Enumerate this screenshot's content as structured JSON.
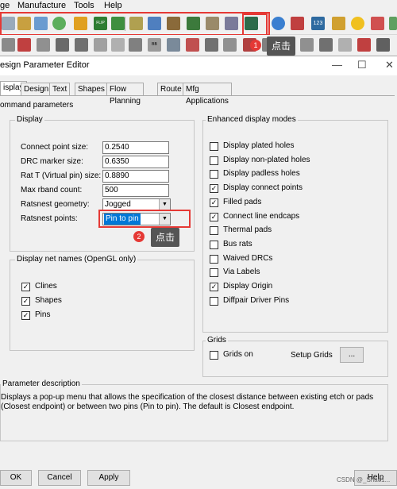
{
  "menubar": {
    "items": [
      "ge",
      "Manufacture",
      "Tools",
      "Help"
    ]
  },
  "toolbar1": {
    "icons": [
      "zoom-icon",
      "zoom-fit-icon",
      "zoom-prev-icon",
      "refresh-icon",
      "3d-view-icon",
      "flip-icon",
      "image-icon",
      "layer-icon",
      "grid-icon",
      "move-icon",
      "placement-icon",
      "route-icon",
      "plot-icon",
      "report-icon",
      "design-parameters-icon",
      "info-icon",
      "pin-icon",
      "reports-123-icon",
      "clean-icon",
      "sun-icon",
      "highlight-icon",
      "drc-icon"
    ],
    "flip_label": "FLIP",
    "count_label": "123"
  },
  "toolbar2": {
    "icons": [
      "dim-icon",
      "align-icon",
      "stretch-icon",
      "spacing-icon",
      "film-icon",
      "pad-icon",
      "slide-icon",
      "via-icon",
      "bbvia-icon",
      "fanout-icon",
      "pinswap-icon",
      "netlog-icon",
      "arc-icon",
      "phase-icon",
      "add-icon",
      "split-icon",
      "text-icon",
      "shape-icon",
      "delay-icon",
      "stack-icon",
      "copy-icon",
      "mirror-icon",
      "analyze-icon",
      "wizard-icon"
    ],
    "bbvia_label": "BB"
  },
  "callouts": [
    {
      "number": "1",
      "text": "点击"
    },
    {
      "number": "2",
      "text": "点击"
    }
  ],
  "dialog": {
    "title": "esign Parameter Editor",
    "window_controls": {
      "minimize": "—",
      "maximize": "☐",
      "close": "✕"
    },
    "tabs": [
      "isplay",
      "Design",
      "Text",
      "Shapes",
      "Flow Planning",
      "Route",
      "Mfg Applications"
    ],
    "section_label": "ommand parameters",
    "display_group": {
      "legend": "Display",
      "fields": [
        {
          "label": "Connect point size:",
          "value": "0.2540"
        },
        {
          "label": "DRC marker size:",
          "value": "0.6350"
        },
        {
          "label": "Rat T (Virtual pin) size:",
          "value": "0.8890"
        },
        {
          "label": "Max rband count:",
          "value": "500"
        }
      ],
      "ratsnest_geometry": {
        "label": "Ratsnest geometry:",
        "value": "Jogged"
      },
      "ratsnest_points": {
        "label": "Ratsnest points:",
        "value": "Pin to pin"
      }
    },
    "net_names_group": {
      "legend": "Display net names (OpenGL only)",
      "items": [
        {
          "label": "Clines",
          "checked": true
        },
        {
          "label": "Shapes",
          "checked": true
        },
        {
          "label": "Pins",
          "checked": true
        }
      ]
    },
    "enhanced_group": {
      "legend": "Enhanced display modes",
      "items": [
        {
          "label": "Display plated holes",
          "checked": false
        },
        {
          "label": "Display non-plated holes",
          "checked": false
        },
        {
          "label": "Display padless holes",
          "checked": false
        },
        {
          "label": "Display connect points",
          "checked": true
        },
        {
          "label": "Filled pads",
          "checked": true
        },
        {
          "label": "Connect line endcaps",
          "checked": true
        },
        {
          "label": "Thermal pads",
          "checked": false
        },
        {
          "label": "Bus rats",
          "checked": false
        },
        {
          "label": "Waived DRCs",
          "checked": false
        },
        {
          "label": "Via Labels",
          "checked": false
        },
        {
          "label": "Display Origin",
          "checked": true
        },
        {
          "label": "Diffpair Driver Pins",
          "checked": false
        }
      ]
    },
    "grids_group": {
      "legend": "Grids",
      "grids_on": {
        "label": "Grids on",
        "checked": false
      },
      "setup_label": "Setup Grids",
      "setup_button": "..."
    },
    "description": {
      "legend": "Parameter description",
      "text": "Displays a pop-up menu that allows the specification of the closest distance between existing etch or pads (Closest endpoint) or between two pins (Pin to pin). The default is Closest endpoint."
    },
    "buttons": {
      "ok": "OK",
      "cancel": "Cancel",
      "apply": "Apply",
      "help": "Help"
    }
  },
  "watermark": "CSDN @_Shao1..."
}
